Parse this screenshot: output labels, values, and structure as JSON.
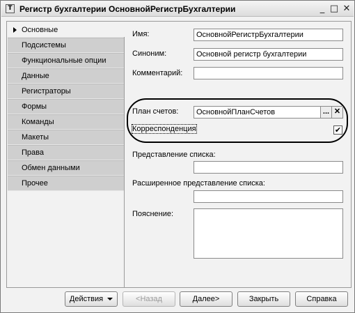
{
  "window": {
    "title": "Регистр бухгалтерии ОсновнойРегистрБухгалтерии",
    "icon_glyph": "Т",
    "minimize_glyph": "_",
    "maximize_glyph": "□",
    "close_glyph": "✕"
  },
  "tabs": [
    {
      "label": "Основные",
      "active": true
    },
    {
      "label": "Подсистемы"
    },
    {
      "label": "Функциональные опции"
    },
    {
      "label": "Данные"
    },
    {
      "label": "Регистраторы"
    },
    {
      "label": "Формы"
    },
    {
      "label": "Команды"
    },
    {
      "label": "Макеты"
    },
    {
      "label": "Права"
    },
    {
      "label": "Обмен данными"
    },
    {
      "label": "Прочее"
    }
  ],
  "form": {
    "name_label": "Имя:",
    "name_value": "ОсновнойРегистрБухгалтерии",
    "synonym_label": "Синоним:",
    "synonym_value": "Основной регистр бухгалтерии",
    "comment_label": "Комментарий:",
    "comment_value": "",
    "chart_label": "План счетов:",
    "chart_value": "ОсновнойПланСчетов",
    "chart_select_glyph": "...",
    "chart_clear_glyph": "✕",
    "correspondence_label": "Корреспонденция",
    "correspondence_checked": true,
    "check_glyph": "✔",
    "list_presentation_label": "Представление списка:",
    "list_presentation_value": "",
    "ext_list_presentation_label": "Расширенное представление списка:",
    "ext_list_presentation_value": "",
    "explanation_label": "Пояснение:",
    "explanation_value": ""
  },
  "buttons": {
    "actions": "Действия",
    "back": "<Назад",
    "next": "Далее>",
    "close": "Закрыть",
    "help": "Справка"
  },
  "icons": {
    "app": "register-icon",
    "active_tab_marker": "triangle-right-icon"
  }
}
